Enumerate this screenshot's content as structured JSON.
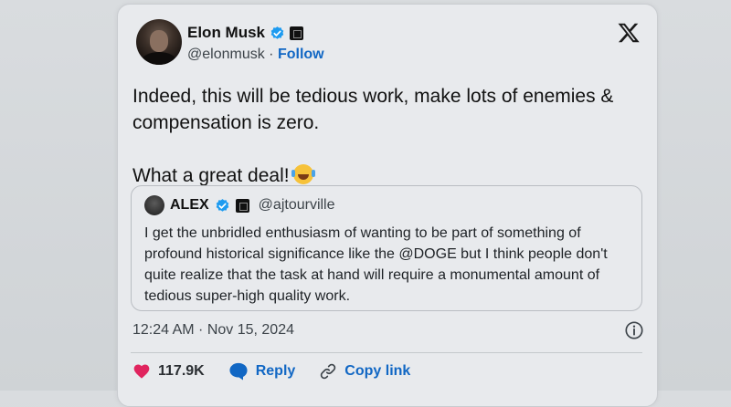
{
  "author": {
    "name": "Elon Musk",
    "handle": "@elonmusk",
    "separator": "·",
    "follow_label": "Follow"
  },
  "tweet": {
    "paragraphs": [
      "Indeed, this will be tedious work, make lots of enemies & compensation is zero.",
      "What a great deal!"
    ],
    "emoji_icon": "face-with-tears-of-joy-icon"
  },
  "quoted": {
    "name": "ALEX",
    "handle": "@ajtourville",
    "text": "I get the unbridled enthusiasm of wanting to be part of something of profound historical significance like the @DOGE but I think people don't quite realize that the task at hand will require a monumental amount of tedious super-high quality work."
  },
  "timestamp": "12:24 AM · Nov 15, 2024",
  "actions": {
    "likes": "117.9K",
    "reply_label": "Reply",
    "copy_link_label": "Copy link"
  },
  "colors": {
    "accent": "#1167c4",
    "like": "#e0245e",
    "verified": "#1d9bf0"
  }
}
